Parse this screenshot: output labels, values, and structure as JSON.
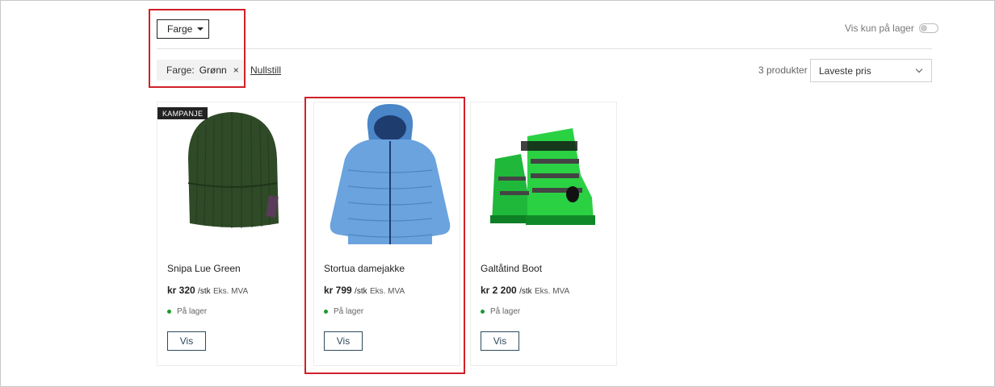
{
  "filters": {
    "color_button_label": "Farge",
    "in_stock_label": "Vis kun på lager",
    "active_filter": {
      "name": "Farge:",
      "value": "Grønn",
      "remove": "×"
    },
    "reset_label": "Nullstill"
  },
  "results": {
    "count": "3 produkter",
    "sort_selected": "Laveste pris"
  },
  "products": [
    {
      "badge": "KAMPANJE",
      "name": "Snipa Lue Green",
      "price": "kr 320",
      "unit": "/stk",
      "vat": "Eks. MVA",
      "stock": "På lager",
      "button": "Vis"
    },
    {
      "name": "Stortua damejakke",
      "price": "kr 799",
      "unit": "/stk",
      "vat": "Eks. MVA",
      "stock": "På lager",
      "button": "Vis"
    },
    {
      "name": "Galtåtind Boot",
      "price": "kr 2 200",
      "unit": "/stk",
      "vat": "Eks. MVA",
      "stock": "På lager",
      "button": "Vis"
    }
  ],
  "colors": {
    "accent": "#2f4a5c",
    "in_stock": "#1a9a2e",
    "highlight": "#d0202a"
  }
}
